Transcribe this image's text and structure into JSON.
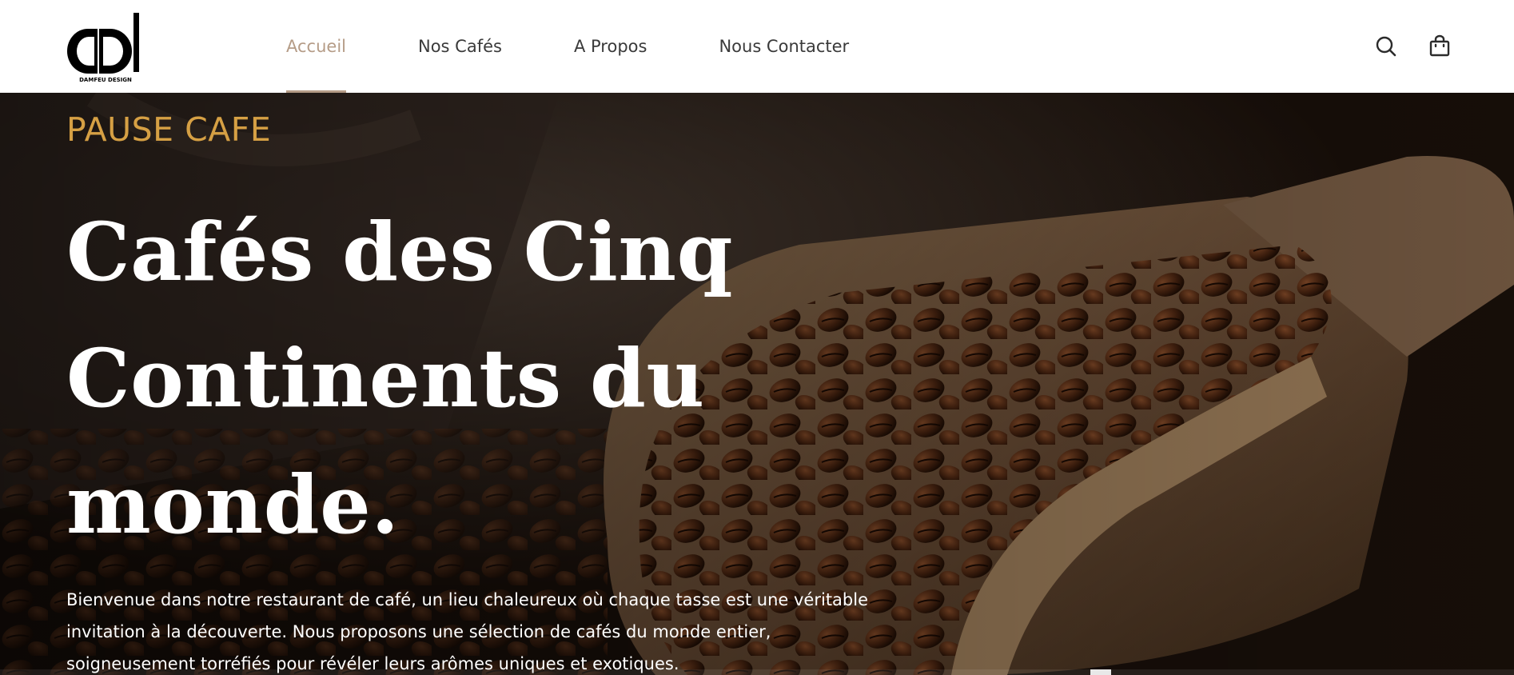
{
  "brand": {
    "logo_text": "DAMFEU DESIGN"
  },
  "nav": {
    "items": [
      {
        "label": "Accueil",
        "active": true
      },
      {
        "label": "Nos Cafés",
        "active": false
      },
      {
        "label": "A Propos",
        "active": false
      },
      {
        "label": "Nous Contacter",
        "active": false
      }
    ]
  },
  "header_icons": {
    "search": "search-icon",
    "cart": "shopping-bag-icon"
  },
  "hero": {
    "eyebrow": "PAUSE CAFE",
    "title_line1": "Cafés des Cinq",
    "title_line2": "Continents du",
    "title_line3": "monde.",
    "text_line1": "Bienvenue dans notre restaurant de café, un lieu chaleureux où chaque tasse est une véritable",
    "text_line2": "invitation à la découverte. Nous proposons une sélection de cafés du monde entier,",
    "text_line3": "soigneusement torréfiés pour révéler leurs arômes uniques et exotiques."
  },
  "colors": {
    "accent": "#d6a044",
    "nav_active": "#b59c87",
    "nav_text": "#3a3a3a",
    "hero_text": "#ffffff"
  }
}
